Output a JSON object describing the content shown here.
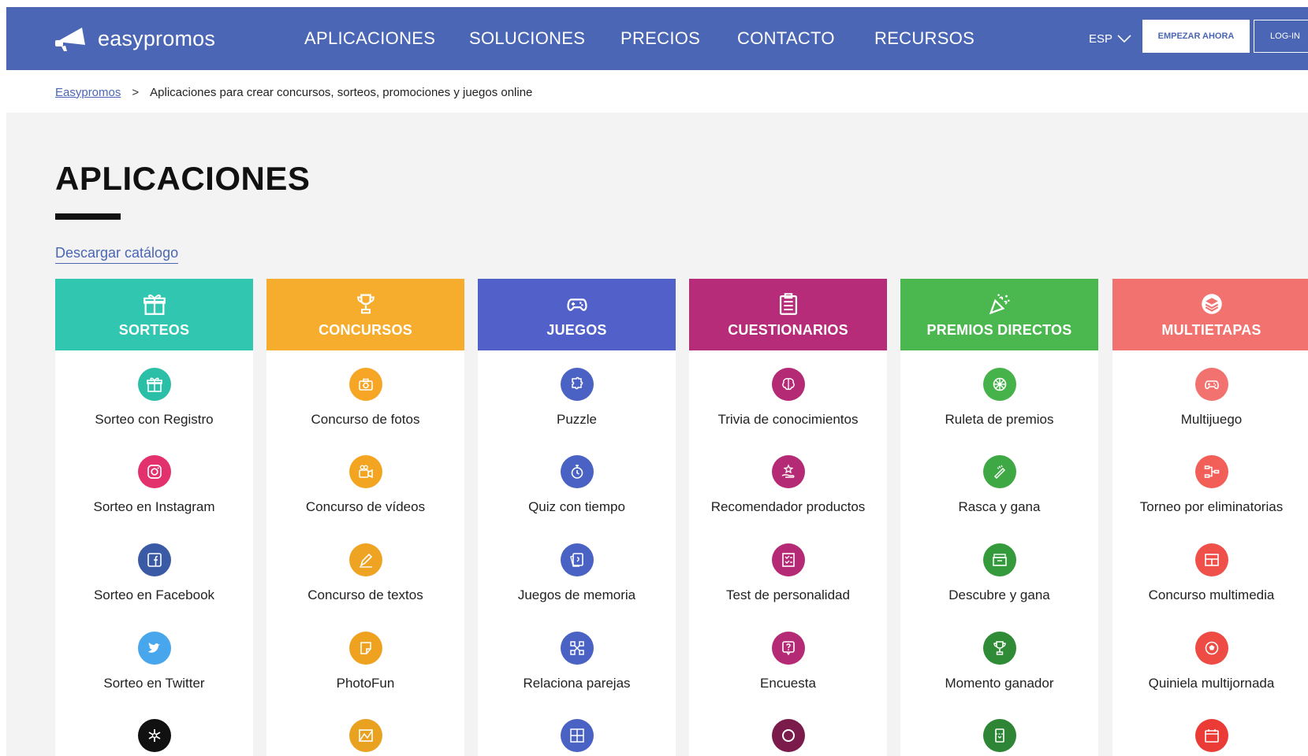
{
  "header": {
    "brand": "easypromos",
    "nav": [
      "APLICACIONES",
      "SOLUCIONES",
      "PRECIOS",
      "CONTACTO",
      "RECURSOS"
    ],
    "lang": "ESP",
    "start_button": "EMPEZAR AHORA",
    "login_button": "LOG-IN"
  },
  "breadcrumb": {
    "home": "Easypromos",
    "separator": ">",
    "current": "Aplicaciones para crear concursos, sorteos, promociones y juegos online"
  },
  "main": {
    "title": "APLICACIONES",
    "download_link": "Descargar catálogo"
  },
  "colors": {
    "nav": "#4a66b5",
    "sorteos": "#30c6b0",
    "concursos": "#f6ad2e",
    "juegos": "#5261c9",
    "cuestionarios": "#b72c78",
    "premios": "#4bb84f",
    "multietapas": "#f2726f"
  },
  "categories": [
    {
      "title": "SORTEOS",
      "icon": "gift-icon",
      "items": [
        {
          "label": "Sorteo con Registro",
          "icon": "gift-icon",
          "color": "#2bbfa8"
        },
        {
          "label": "Sorteo en Instagram",
          "icon": "instagram-icon",
          "color": "#e2316c"
        },
        {
          "label": "Sorteo en Facebook",
          "icon": "facebook-icon",
          "color": "#3b5aa5"
        },
        {
          "label": "Sorteo en Twitter",
          "icon": "twitter-icon",
          "color": "#48a6ec"
        },
        {
          "label": "",
          "icon": "asterisk-icon",
          "color": "#111111"
        }
      ]
    },
    {
      "title": "CONCURSOS",
      "icon": "trophy-icon",
      "items": [
        {
          "label": "Concurso de fotos",
          "icon": "camera-icon",
          "color": "#f6a524"
        },
        {
          "label": "Concurso de vídeos",
          "icon": "video-camera-icon",
          "color": "#f3a522"
        },
        {
          "label": "Concurso de textos",
          "icon": "pen-icon",
          "color": "#eea322"
        },
        {
          "label": "PhotoFun",
          "icon": "sticker-icon",
          "color": "#efa220"
        },
        {
          "label": "",
          "icon": "image-frame-icon",
          "color": "#e9a120"
        }
      ]
    },
    {
      "title": "JUEGOS",
      "icon": "gamepad-icon",
      "items": [
        {
          "label": "Puzzle",
          "icon": "puzzle-icon",
          "color": "#4a62c3"
        },
        {
          "label": "Quiz con tiempo",
          "icon": "stopwatch-icon",
          "color": "#4a62c3"
        },
        {
          "label": "Juegos de memoria",
          "icon": "cards-icon",
          "color": "#4a62c3"
        },
        {
          "label": "Relaciona parejas",
          "icon": "connect-icon",
          "color": "#4a62c3"
        },
        {
          "label": "",
          "icon": "letters-grid-icon",
          "color": "#4a62c3"
        }
      ]
    },
    {
      "title": "CUESTIONARIOS",
      "icon": "clipboard-icon",
      "items": [
        {
          "label": "Trivia de conocimientos",
          "icon": "brain-icon",
          "color": "#b52a74"
        },
        {
          "label": "Recomendador productos",
          "icon": "hand-star-icon",
          "color": "#b52a74"
        },
        {
          "label": "Test de personalidad",
          "icon": "checklist-icon",
          "color": "#b52a74"
        },
        {
          "label": "Encuesta",
          "icon": "question-bubble-icon",
          "color": "#b52a74"
        },
        {
          "label": "",
          "icon": "ring-icon",
          "color": "#7a1b4c"
        }
      ]
    },
    {
      "title": "PREMIOS DIRECTOS",
      "icon": "party-popper-icon",
      "items": [
        {
          "label": "Ruleta de premios",
          "icon": "wheel-icon",
          "color": "#45b24a"
        },
        {
          "label": "Rasca y gana",
          "icon": "scratch-icon",
          "color": "#3ea845"
        },
        {
          "label": "Descubre y gana",
          "icon": "box-icon",
          "color": "#349a3c"
        },
        {
          "label": "Momento ganador",
          "icon": "trophy-icon",
          "color": "#2f8b36"
        },
        {
          "label": "",
          "icon": "ticket-icon",
          "color": "#2e8535"
        }
      ]
    },
    {
      "title": "MULTIETAPAS",
      "icon": "layers-icon",
      "items": [
        {
          "label": "Multijuego",
          "icon": "gamepad-icon",
          "color": "#f2726f"
        },
        {
          "label": "Torneo por eliminatorias",
          "icon": "bracket-icon",
          "color": "#f25f58"
        },
        {
          "label": "Concurso multimedia",
          "icon": "layout-icon",
          "color": "#ef504a"
        },
        {
          "label": "Quiniela multijornada",
          "icon": "ball-icon",
          "color": "#ee4b45"
        },
        {
          "label": "",
          "icon": "calendar-icon",
          "color": "#ea3b36"
        }
      ]
    }
  ]
}
